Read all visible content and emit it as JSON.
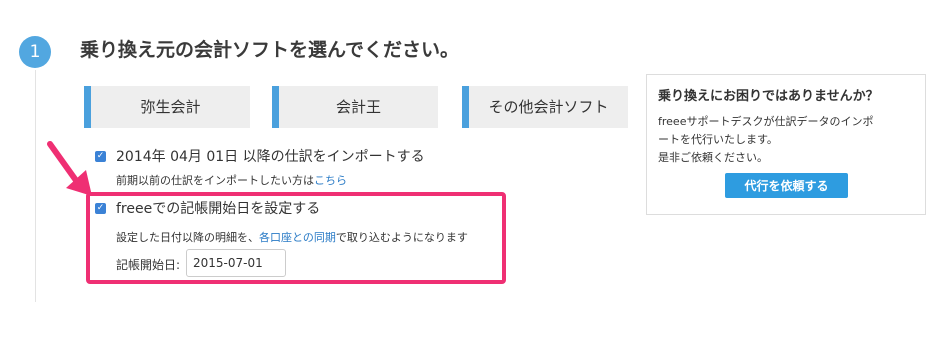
{
  "step": {
    "number": "1",
    "title": "乗り換え元の会計ソフトを選んでください。"
  },
  "software_options": [
    {
      "label": "弥生会計"
    },
    {
      "label": "会計王"
    },
    {
      "label": "その他会計ソフト"
    }
  ],
  "import_option": {
    "checked": true,
    "label": "2014年 04月 01日 以降の仕訳をインポートする",
    "hint_prefix": "前期以前の仕訳をインポートしたい方は",
    "hint_link": "こちら"
  },
  "start_date_option": {
    "checked": true,
    "label": "freeeでの記帳開始日を設定する",
    "desc_prefix": "設定した日付以降の明細を、",
    "desc_link": "各口座との同期",
    "desc_suffix": "で取り込むようになります",
    "field_label": "記帳開始日:",
    "field_value": "2015-07-01"
  },
  "help": {
    "title": "乗り換えにお困りではありませんか？",
    "line1": "freeeサポートデスクが仕訳データのインポ",
    "line2": "ートを代行いたします。",
    "line3": "是非ご依頼ください。",
    "button": "代行を依頼する"
  },
  "colors": {
    "accent_blue": "#4aa0dd",
    "highlight_pink": "#ef2f73",
    "link_blue": "#2a7bc6",
    "button_blue": "#2e9ce0"
  },
  "icons": {
    "annotation_arrow": "arrow-pointing-down-right",
    "checkbox": "checkmark"
  }
}
